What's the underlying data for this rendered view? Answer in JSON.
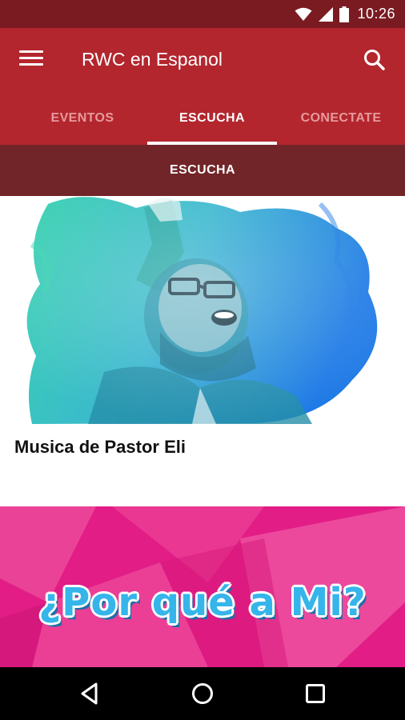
{
  "status_bar": {
    "time": "10:26",
    "icons": [
      "wifi-icon",
      "signal-icon",
      "battery-icon"
    ]
  },
  "app_bar": {
    "title": "RWC en Espanol",
    "menu_icon": "hamburger-menu-icon",
    "search_icon": "search-icon"
  },
  "tabs": [
    {
      "label": "EVENTOS",
      "active": false
    },
    {
      "label": "ESCUCHA",
      "active": true
    },
    {
      "label": "CONECTATE",
      "active": false
    }
  ],
  "section": {
    "title": "ESCUCHA"
  },
  "cards": [
    {
      "title": "Musica de Pastor Eli",
      "image": "worship-photo-teal-blue"
    }
  ],
  "banner": {
    "text": "¿Por qué a Mi?"
  },
  "nav_bar": {
    "icons": [
      "back-icon",
      "home-icon",
      "recents-icon"
    ]
  },
  "colors": {
    "status_bar": "#7a1b21",
    "primary": "#b3262e",
    "subheader": "#722528",
    "tab_inactive": "#e79a9d",
    "banner_pink": "#e21d86",
    "banner_text": "#35b5ea"
  }
}
